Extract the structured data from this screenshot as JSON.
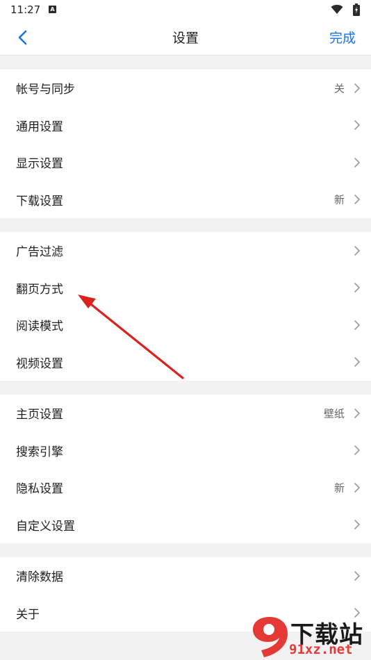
{
  "status_bar": {
    "time": "11:27",
    "notification_icon": "a-icon",
    "wifi_icon": "wifi-icon",
    "battery_icon": "battery-icon"
  },
  "header": {
    "back_icon": "chevron-left-icon",
    "title": "设置",
    "done_label": "完成",
    "accent_color": "#1a73e8"
  },
  "groups": [
    {
      "items": [
        {
          "label": "帐号与同步",
          "value": "关"
        },
        {
          "label": "通用设置",
          "value": ""
        },
        {
          "label": "显示设置",
          "value": ""
        },
        {
          "label": "下载设置",
          "value": "新"
        }
      ]
    },
    {
      "items": [
        {
          "label": "广告过滤",
          "value": ""
        },
        {
          "label": "翻页方式",
          "value": ""
        },
        {
          "label": "阅读模式",
          "value": ""
        },
        {
          "label": "视频设置",
          "value": ""
        }
      ]
    },
    {
      "items": [
        {
          "label": "主页设置",
          "value": "壁纸"
        },
        {
          "label": "搜索引擎",
          "value": ""
        },
        {
          "label": "隐私设置",
          "value": "新"
        },
        {
          "label": "自定义设置",
          "value": ""
        }
      ]
    },
    {
      "items": [
        {
          "label": "清除数据",
          "value": ""
        },
        {
          "label": "关于",
          "value": ""
        }
      ]
    }
  ],
  "annotation": {
    "arrow_color": "#d9211e"
  },
  "watermark": {
    "logo_text": "9",
    "text": "下载站",
    "url": "91xz.net"
  }
}
